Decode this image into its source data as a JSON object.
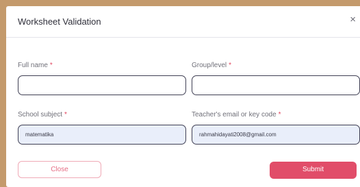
{
  "dialog": {
    "title": "Worksheet Validation",
    "close_icon": "×"
  },
  "fields": {
    "full_name": {
      "label": "Full name",
      "required_mark": "*",
      "value": ""
    },
    "group_level": {
      "label": "Group/level",
      "required_mark": "*",
      "value": ""
    },
    "school_subject": {
      "label": "School subject",
      "required_mark": "*",
      "value": "matematika"
    },
    "teacher_email": {
      "label": "Teacher's email or key code",
      "required_mark": "*",
      "value": "rahmahidayati2008@gmail.com"
    }
  },
  "buttons": {
    "close_label": "Close",
    "submit_label": "Submit"
  },
  "colors": {
    "accent": "#e14d69",
    "backdrop": "#c49a6c"
  }
}
